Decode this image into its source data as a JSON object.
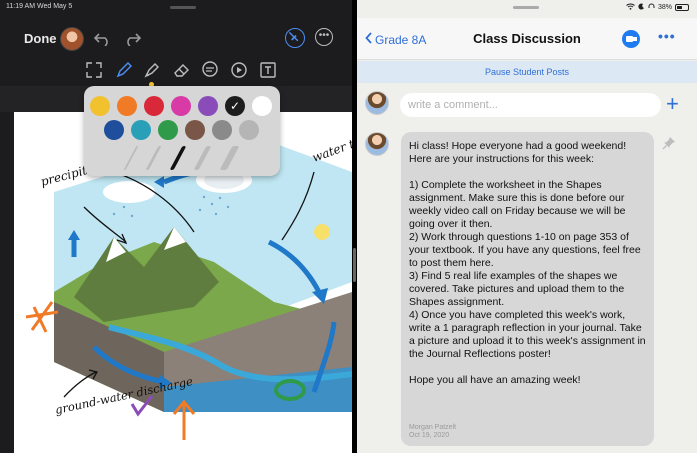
{
  "status": {
    "left_text": "11:19 AM  Wed May 5",
    "right_text": "38%"
  },
  "left_pane": {
    "done_label": "Done",
    "icons": {
      "undo": "undo-icon",
      "redo": "redo-icon",
      "pencil_off": "pencil-slash-icon",
      "more": "ellipsis-circle-icon"
    },
    "tools": [
      "expand-icon",
      "pen-icon",
      "marker-icon",
      "eraser-icon",
      "comment-icon",
      "record-icon",
      "text-box-icon"
    ],
    "palette": {
      "row1": [
        "#f2c12e",
        "#f07a26",
        "#d8283a",
        "#d83aa6",
        "#8a4cb8",
        "#1d1d1d",
        "#ffffff"
      ],
      "row2": [
        "#1f4e9c",
        "#2aa0b8",
        "#2f9a4a",
        "#7a5648",
        "#8a8a8a",
        "#b5b5b5"
      ],
      "selected_index": 5,
      "stroke_sizes": [
        "thin",
        "thin",
        "medium",
        "thick",
        "thick"
      ]
    },
    "handwriting": {
      "precip": "precipitation (rain & snow)",
      "water": "water the",
      "ground": "ground-water discharge"
    }
  },
  "right_pane": {
    "back_label": "Grade 8A",
    "title": "Class Discussion",
    "pause_label": "Pause Student Posts",
    "comment_placeholder": "write a comment...",
    "post": {
      "body": "Hi class! Hope everyone had a good weekend!\nHere are your instructions for this week:\n\n1) Complete the worksheet in the Shapes assignment. Make sure this is done before our weekly video call on Friday because we will be going over it then.\n2) Work through questions 1-10 on page 353 of your textbook. If you have any questions, feel free to post them here.\n3) Find 5 real life examples of the shapes we covered. Take pictures and upload them to the Shapes assignment.\n4) Once you have completed this week's work, write a 1 paragraph reflection in your journal. Take a picture and upload it to this week's assignment in the Journal Reflections poster!\n\nHope you all have an amazing week!",
      "author": "Morgan Patzelt",
      "date": "Oct 19, 2020"
    }
  }
}
